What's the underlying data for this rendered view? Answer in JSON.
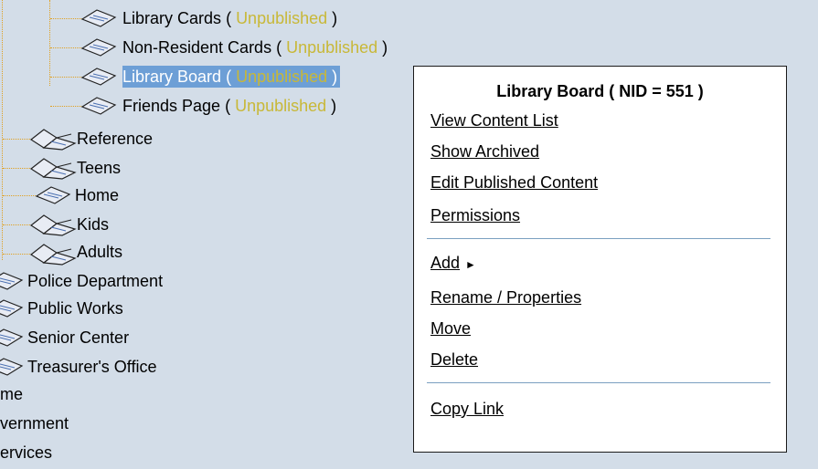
{
  "tree": {
    "unpublished_open": "( ",
    "unpublished_text": "Unpublished",
    "unpublished_close": " )",
    "children": [
      {
        "label": "Library Cards",
        "status": "Unpublished"
      },
      {
        "label": "Non-Resident Cards",
        "status": "Unpublished"
      },
      {
        "label": "Library Board",
        "status": "Unpublished"
      },
      {
        "label": "Friends Page",
        "status": "Unpublished"
      }
    ],
    "library_sections": [
      "Reference",
      "Teens",
      "Home",
      "Kids",
      "Adults"
    ],
    "departments": [
      "Police Department",
      "Public Works",
      "Senior Center",
      "Treasurer's Office"
    ],
    "top_level": [
      "me",
      "vernment",
      "ervices"
    ]
  },
  "context_menu": {
    "title": "Library Board ( NID = 551 )",
    "items_group1": [
      "View Content List",
      "Show Archived",
      "Edit Published Content",
      "Permissions"
    ],
    "items_group2": [
      "Add",
      "Rename / Properties",
      "Move",
      "Delete"
    ],
    "add_arrow": "►",
    "items_group3": [
      "Copy Link"
    ]
  }
}
